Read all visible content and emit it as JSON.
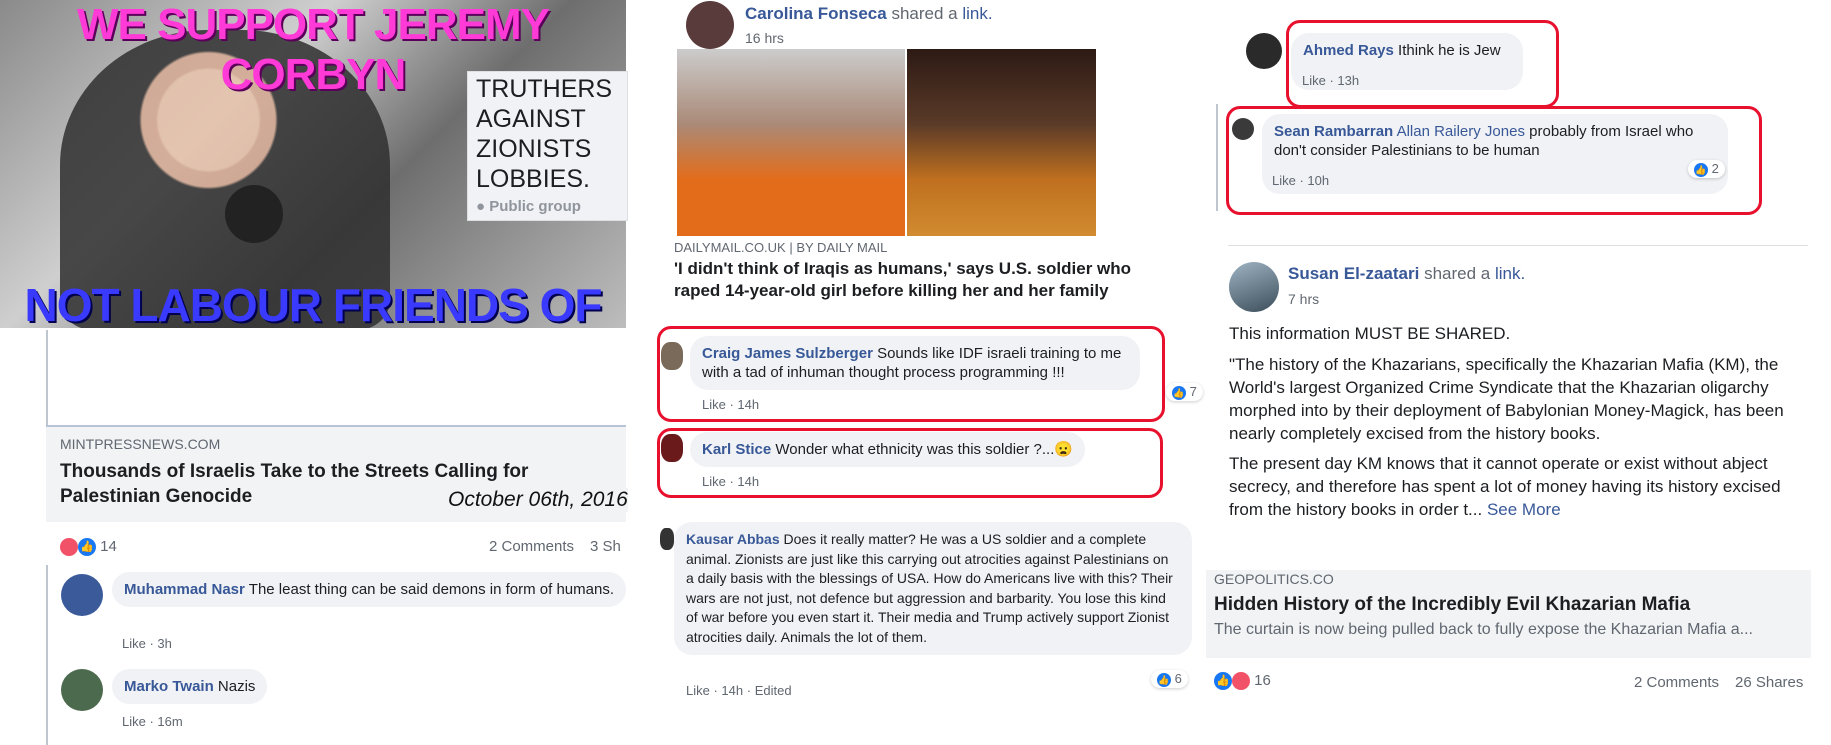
{
  "panel1": {
    "banner_top": "WE SUPPORT JEREMY CORBYN",
    "banner_bottom": "NOT LABOUR FRIENDS OF ISRAEL!",
    "group_name": "TRUTHERS AGAINST ZIONISTS LOBBIES.",
    "group_type": "Public group",
    "link_source": "MINTPRESSNEWS.COM",
    "link_title": "Thousands of Israelis Take to the Streets Calling for Palestinian Genocide",
    "date_stamp": "October 06th, 2016",
    "reaction_count": "14",
    "comments_count": "2 Comments",
    "shares_count": "3 Sh",
    "comments": [
      {
        "author": "Muhammad Nasr",
        "text": "The least thing can be said demons in form of humans.",
        "like": "Like",
        "time": "3h"
      },
      {
        "author": "Marko Twain",
        "text": "Nazis",
        "like": "Like",
        "time": "16m"
      }
    ]
  },
  "panel2": {
    "poster": "Carolina Fonseca",
    "action": "shared a",
    "action_link": "link.",
    "time": "16 hrs",
    "link_source": "DAILYMAIL.CO.UK | BY DAILY MAIL",
    "link_title": "'I didn't think of Iraqis as humans,' says U.S. soldier who raped 14-year-old girl before killing her and her family",
    "comments": [
      {
        "author": "Craig James Sulzberger",
        "text": "Sounds like IDF israeli training to me with a tad of inhuman thought process programming !!!",
        "like": "Like",
        "time": "14h",
        "likes": "7"
      },
      {
        "author": "Karl Stice",
        "text": "Wonder what ethnicity was this soldier ?...😦",
        "like": "Like",
        "time": "14h"
      },
      {
        "author": "Kausar Abbas",
        "text": "Does it really matter? He was a US soldier and a complete animal. Zionists are just like this carrying out atrocities against Palestinians on a daily basis with the blessings of USA. How do Americans live with this? Their wars are not just, not defence but aggression and barbarity. You lose this kind of war before you even start it. Their media and Trump actively support Zionist atrocities daily. Animals the lot of them.",
        "like": "Like",
        "time": "14h",
        "edited": "Edited",
        "likes": "6"
      }
    ]
  },
  "panel3": {
    "comments": [
      {
        "author": "Ahmed Rays",
        "text": "Ithink he is Jew",
        "like": "Like",
        "time": "13h"
      },
      {
        "author": "Sean Rambarran",
        "mention": "Allan Railery Jones",
        "text": "probably from Israel who don't consider Palestinians to be human",
        "like": "Like",
        "time": "10h",
        "likes": "2"
      }
    ],
    "poster": "Susan El-zaatari",
    "action": "shared a",
    "action_link": "link.",
    "time": "7 hrs",
    "headline": "This information MUST BE SHARED.",
    "body": "\"The history of the Khazarians, specifically the Khazarian Mafia (KM), the World's largest Organized Crime Syndicate that the Khazarian oligarchy morphed into by their deployment of Babylonian Money-Magick, has been nearly completely excised from the history books.",
    "body2": "The present day KM knows that it cannot operate or exist without abject secrecy, and therefore has spent a lot of money having its history excised from the history books in order t...",
    "see_more": "See More",
    "link_source": "GEOPOLITICS.CO",
    "link_title": "Hidden History of the Incredibly Evil Khazarian Mafia",
    "link_desc": "The curtain is now being pulled back to fully expose the Khazarian Mafia a...",
    "reaction_count": "16",
    "comments_count": "2 Comments",
    "shares_count": "26 Shares"
  },
  "colors": {
    "accent": "#385898",
    "highlight": "#e8112d",
    "like": "#1877f2",
    "angry": "#f25268"
  }
}
